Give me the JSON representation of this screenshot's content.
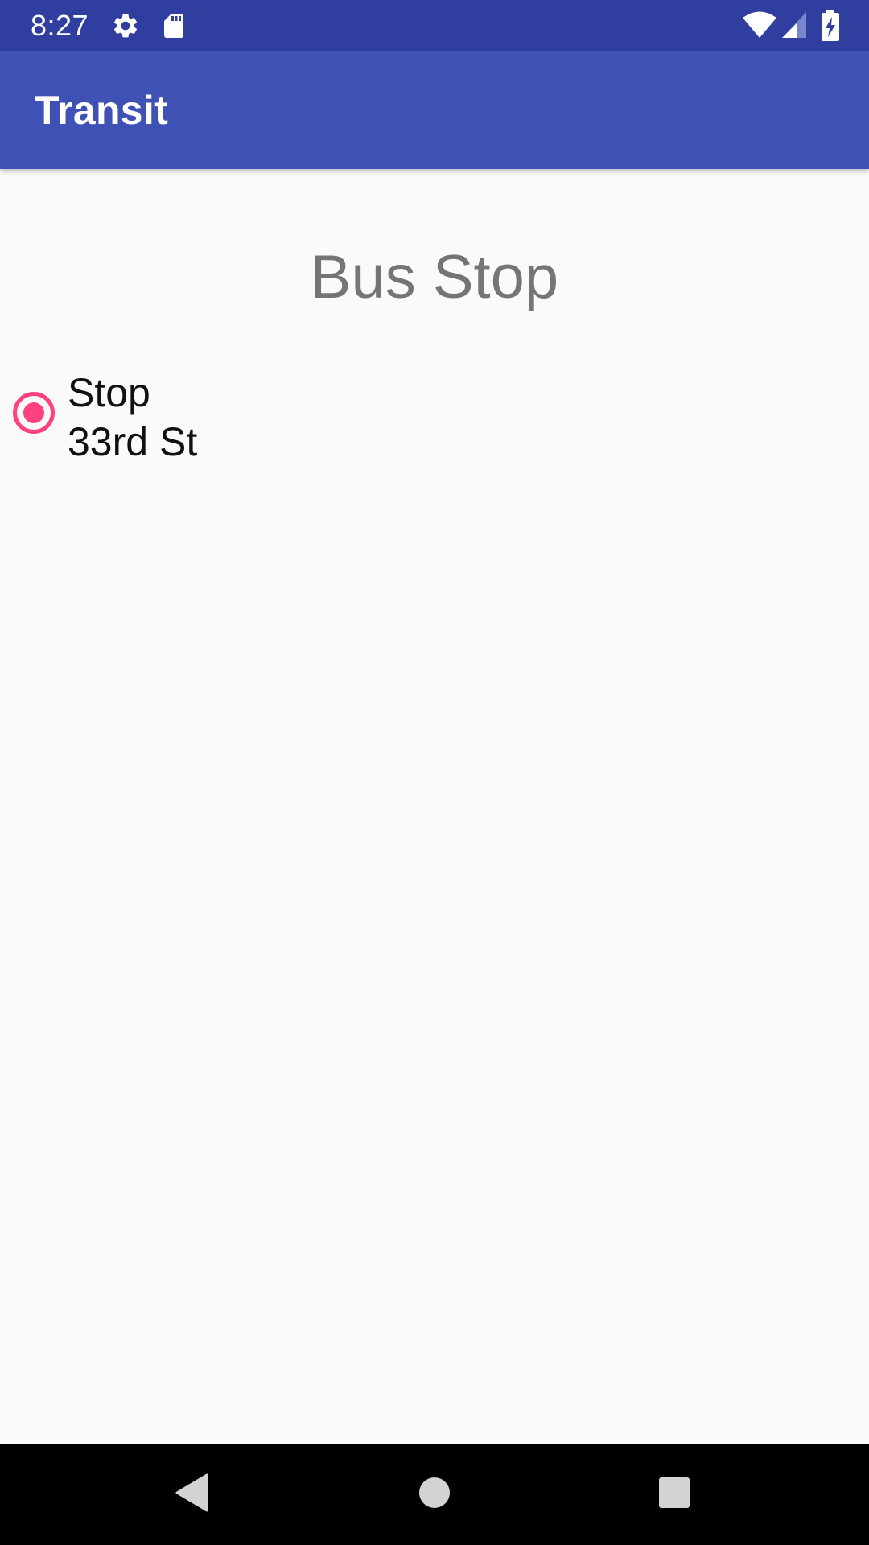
{
  "status_bar": {
    "time": "8:27",
    "icons": [
      "settings-icon",
      "sd-card-icon",
      "wifi-icon",
      "cell-signal-icon",
      "battery-charging-icon"
    ]
  },
  "app_bar": {
    "title": "Transit"
  },
  "main": {
    "heading": "Bus Stop",
    "options": [
      {
        "label_line1": "Stop",
        "label_line2": "33rd St",
        "selected": true
      }
    ]
  },
  "nav_bar": {
    "buttons": [
      "back-icon",
      "home-icon",
      "recents-icon"
    ]
  },
  "colors": {
    "status_bar": "#303f9f",
    "app_bar": "#3f51b5",
    "accent": "#ff4081",
    "background": "#fafafa",
    "heading_text": "#757575"
  }
}
